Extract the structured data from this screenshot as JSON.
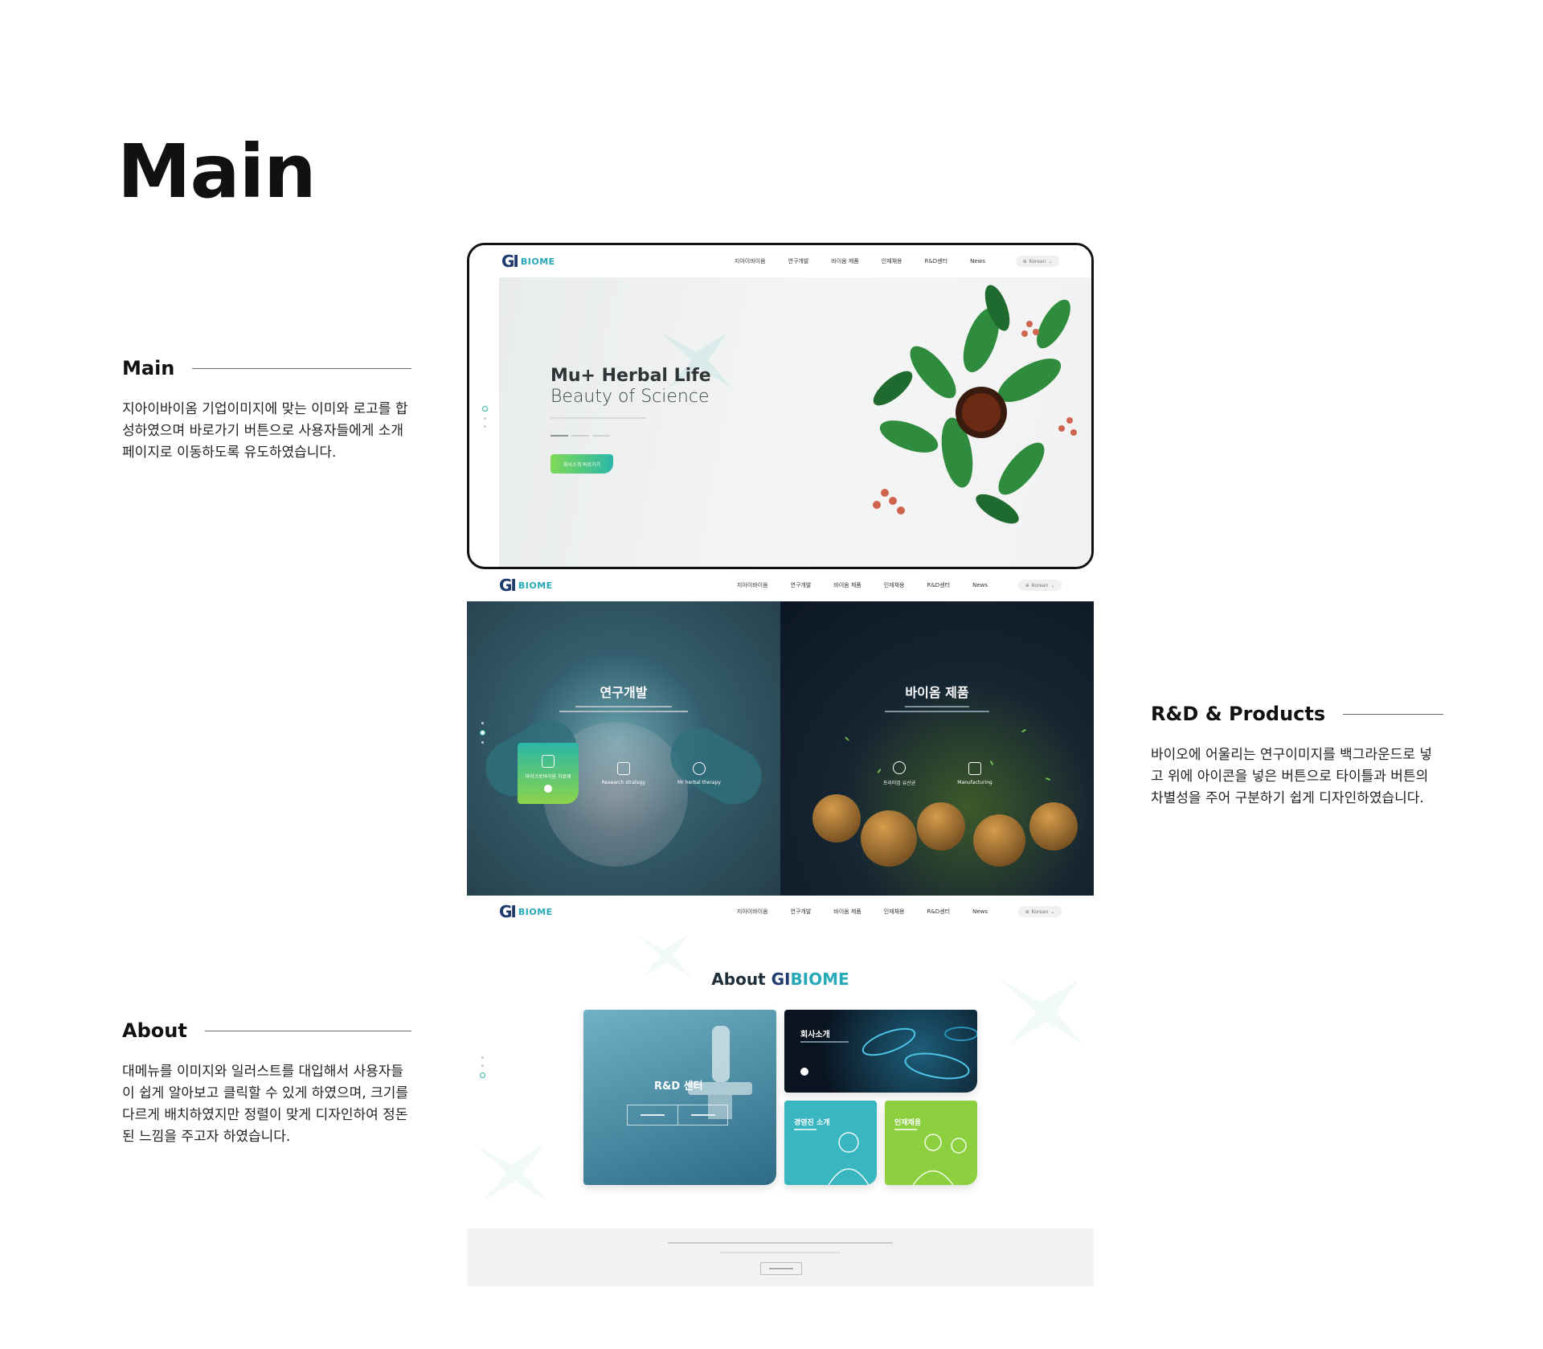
{
  "page": {
    "heading": "Main"
  },
  "annotations": {
    "main": {
      "title": "Main",
      "text": "지아이바이옴 기업이미지에 맞는 이미와 로고를 합성하였으며 바로가기 버튼으로 사용자들에게 소개페이지로 이동하도록 유도하였습니다."
    },
    "rd": {
      "title": "R&D & Products",
      "text": "바이오에 어울리는 연구이미지를 백그라운드로 넣고 위에 아이콘을 넣은 버튼으로 타이틀과 버튼의 차별성을 주어 구분하기 쉽게 디자인하였습니다."
    },
    "about": {
      "title": "About",
      "text": "대메뉴를 이미지와 일러스트를 대입해서 사용자들이 쉽게 알아보고 클릭할 수 있게 하였으며, 크기를 다르게 배치하였지만 정렬이 맞게 디자인하여 정돈된 느낌을 주고자 하였습니다."
    }
  },
  "nav": {
    "logo_mark": "GI",
    "logo_text": "BIOME",
    "items": [
      "지아이바이옴",
      "연구개발",
      "바이옴 제품",
      "인재채용",
      "R&D센터",
      "News"
    ],
    "lang": "Korean"
  },
  "hero": {
    "title": "Mu+ Herbal Life",
    "subtitle": "Beauty of Science",
    "cta": "회사소개 바로가기"
  },
  "rd": {
    "left": {
      "title": "연구개발",
      "cards": [
        "마이크로바이옴 치료제",
        "Research strategy",
        "Mr herbal therapy"
      ]
    },
    "right": {
      "title": "바이옴 제품",
      "cards": [
        "프리미엄 유산균",
        "Manufacturing"
      ]
    }
  },
  "about": {
    "title_prefix": "About ",
    "title_gi": "GI",
    "title_biome": "BIOME",
    "rd_center": {
      "title": "R&D 센터"
    },
    "company": {
      "title": "회사소개"
    },
    "ceo": {
      "title": "경영진 소개"
    },
    "hr": {
      "title": "인재채용"
    }
  },
  "colors": {
    "brand_navy": "#1f3b6e",
    "brand_teal": "#27a9b8",
    "brand_green": "#8ccf3f"
  }
}
